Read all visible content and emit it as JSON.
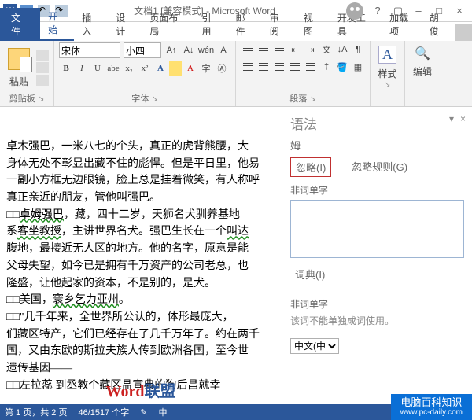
{
  "titlebar": {
    "app_icon": "W",
    "title_text": "文档1 [兼容模式] - Microsoft Word",
    "help_icon": "?",
    "ribbon_toggle": "▢",
    "min_icon": "–",
    "max_icon": "□",
    "close_icon": "×"
  },
  "tabs": {
    "file": "文件",
    "items": [
      "开始",
      "插入",
      "设计",
      "页面布局",
      "引用",
      "邮件",
      "审阅",
      "视图",
      "开发工具",
      "加载项"
    ],
    "user": "胡俊"
  },
  "ribbon": {
    "clipboard": {
      "paste": "粘贴",
      "label": "剪贴板"
    },
    "font": {
      "name": "宋体",
      "size": "小四",
      "wen": "wén",
      "btns_row2": [
        "B",
        "I",
        "U",
        "abe",
        "x₂",
        "x²",
        "A"
      ],
      "label": "字体"
    },
    "paragraph": {
      "label": "段落"
    },
    "styles": {
      "glyph": "A",
      "label": "样式"
    },
    "editing": {
      "glyph": "🔍",
      "label": "编辑"
    }
  },
  "doc": {
    "lines": [
      "卓木强巴，一米八七的个头，真正的虎背熊腰，大",
      "身体无处不彰显出藏不住的彪悍。但是平日里，他易",
      "一副小方框无边眼镜，脸上总是挂着微笑，有人称呼",
      "真正亲近的朋友，管他叫强巴。",
      "□□卓姆强巴，藏，四十二岁，天狮名犬驯养基地",
      "系客坐教授，主讲世界名犬。强巴生长在一个叫达",
      "腹地，最接近无人区的地方。他的名字，原意是能",
      "父母失望，如今已是拥有千万资产的公司老总，也",
      "隆盛，让他起家的资本，不是别的，是犬。",
      "□□美国，寰乡乞力亚州。",
      "□□\"几千年来，全世界所公认的，体形最庞大，",
      "们藏区特产，它们已经存在了几千万年了。约在两千",
      "国，又由东欧的斯拉夫族人传到欧洲各国，至今世",
      "遗传基因——",
      "□□左拉蕊 到丞教个藏区昷宣典的狗后昌就幸"
    ],
    "watermark": {
      "red": "Word",
      "blue": "联盟"
    }
  },
  "panel": {
    "title": "语法",
    "dropdown_icon": "▾",
    "close_icon": "×",
    "subject": "姆",
    "ignore": "忽略(I)",
    "ignore_rule": "忽略规则(G)",
    "section1": "非词单字",
    "dictionary": "词典(I)",
    "section2": "非词单字",
    "note": "该词不能单独成词使用。",
    "lang_value": "中文(中"
  },
  "status": {
    "page": "第 1 页，共 2 页",
    "words": "46/1517 个字",
    "proof": "✎",
    "lang": "中"
  },
  "corner": {
    "big": "电脑百科知识",
    "small": "www.pc-daily.com"
  }
}
